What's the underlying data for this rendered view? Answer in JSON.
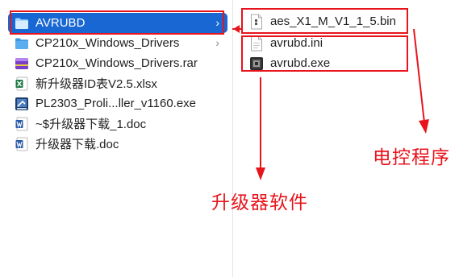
{
  "left_column": {
    "items": [
      {
        "label": "AVRUBD",
        "icon": "folder-icon",
        "selected": true,
        "has_chevron": true
      },
      {
        "label": "CP210x_Windows_Drivers",
        "icon": "folder-icon",
        "selected": false,
        "has_chevron": true
      },
      {
        "label": "CP210x_Windows_Drivers.rar",
        "icon": "rar-archive-icon",
        "selected": false,
        "has_chevron": false
      },
      {
        "label": "新升级器ID表V2.5.xlsx",
        "icon": "excel-file-icon",
        "selected": false,
        "has_chevron": false
      },
      {
        "label": "PL2303_Proli...ller_v1160.exe",
        "icon": "exe-file-icon",
        "selected": false,
        "has_chevron": false
      },
      {
        "label": "~$升级器下载_1.doc",
        "icon": "word-file-icon",
        "selected": false,
        "has_chevron": false
      },
      {
        "label": "升级器下载.doc",
        "icon": "word-file-icon",
        "selected": false,
        "has_chevron": false
      }
    ],
    "chevron": "›"
  },
  "right_column": {
    "items": [
      {
        "label": "aes_X1_M_V1_1_5.bin",
        "icon": "bin-file-icon"
      },
      {
        "label": "avrubd.ini",
        "icon": "ini-file-icon"
      },
      {
        "label": "avrubd.exe",
        "icon": "exe-file-icon"
      }
    ]
  },
  "annotations": {
    "upgrader_software": "升级器软件",
    "ecu_program": "电控程序"
  },
  "colors": {
    "selection": "#1967d2",
    "annotation_red": "#e8141c",
    "folder": "#5aaef0"
  }
}
